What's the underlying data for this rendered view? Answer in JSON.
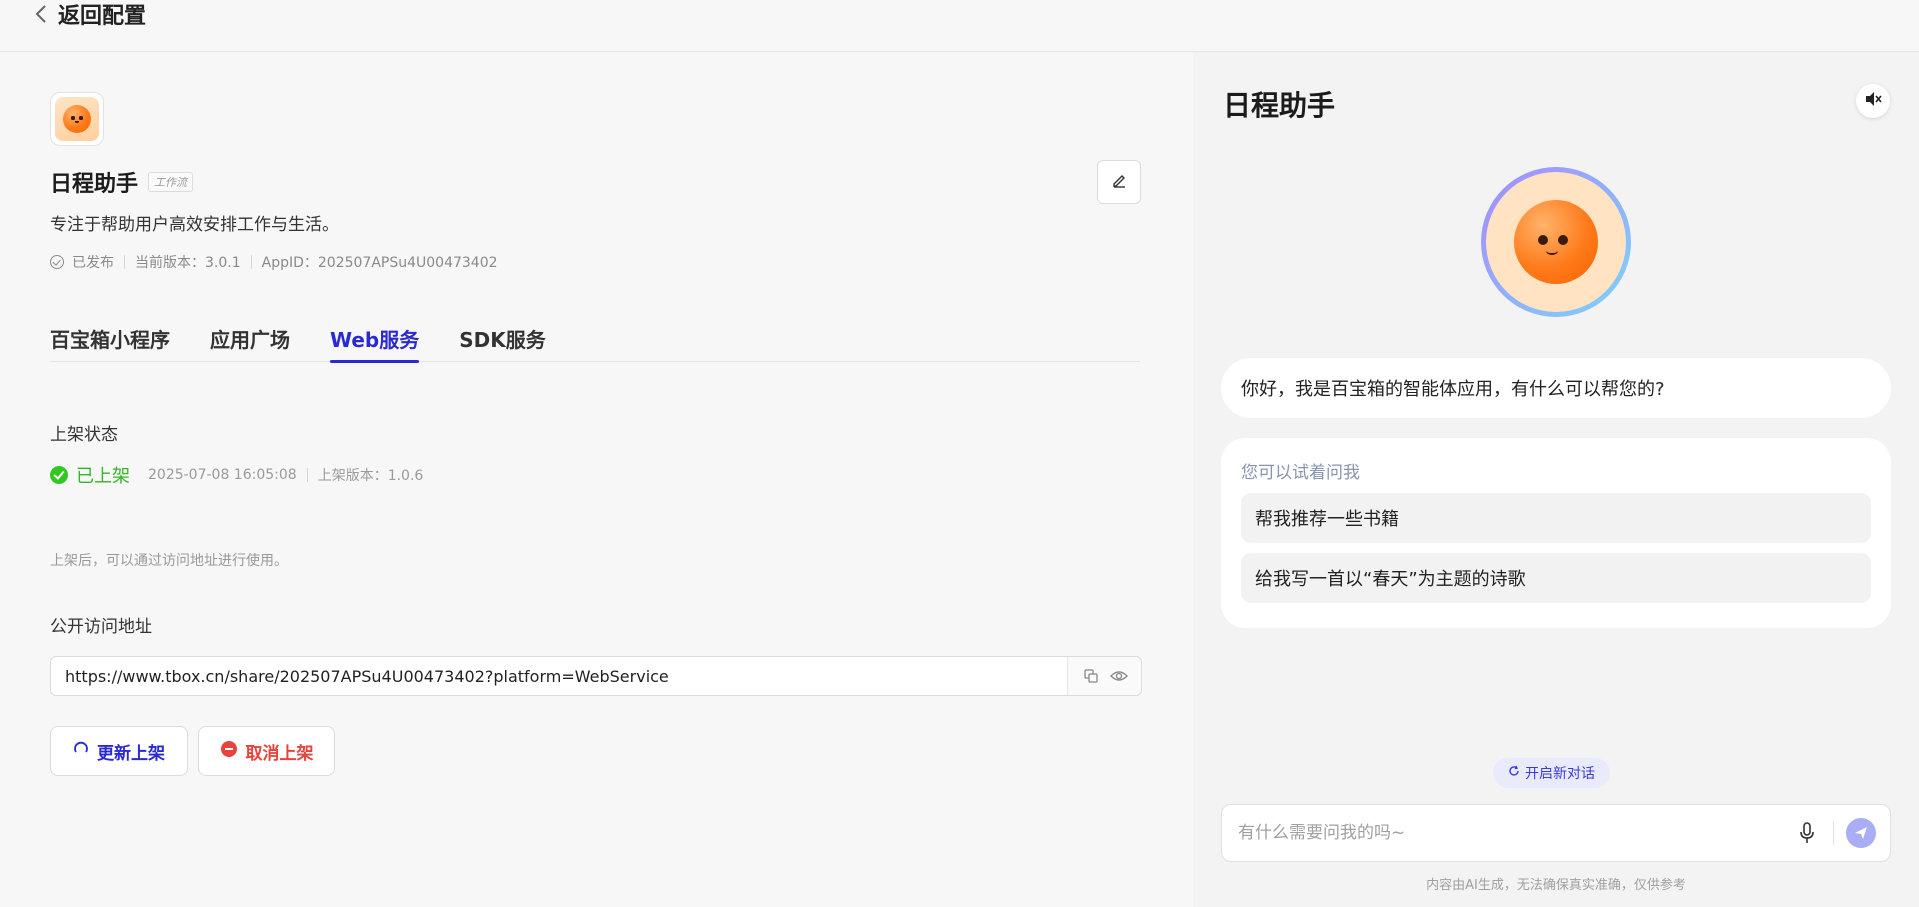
{
  "header": {
    "back_label": "返回配置"
  },
  "app": {
    "name": "日程助手",
    "type_badge": "工作流",
    "description": "专注于帮助用户高效安排工作与生活。",
    "status": "已发布",
    "version": "当前版本：3.0.1",
    "app_id": "AppID：202507APSu4U00473402"
  },
  "tabs": [
    {
      "label": "百宝箱小程序",
      "active": false
    },
    {
      "label": "应用广场",
      "active": false
    },
    {
      "label": "Web服务",
      "active": true
    },
    {
      "label": "SDK服务",
      "active": false
    }
  ],
  "listing": {
    "section_label": "上架状态",
    "status": "已上架",
    "timestamp": "2025-07-08 16:05:08",
    "listed_version": "上架版本：1.0.6",
    "hint": "上架后，可以通过访问地址进行使用。"
  },
  "public_url": {
    "section_label": "公开访问地址",
    "value": "https://www.tbox.cn/share/202507APSu4U00473402?platform=WebService"
  },
  "actions": {
    "update": "更新上架",
    "cancel": "取消上架"
  },
  "chat": {
    "title": "日程助手",
    "greeting": "你好，我是百宝箱的智能体应用，有什么可以帮您的?",
    "suggest_title": "您可以试着问我",
    "suggestions": [
      "帮我推荐一些书籍",
      "给我写一首以“春天”为主题的诗歌"
    ],
    "new_chat": "开启新对话",
    "input_placeholder": "有什么需要问我的吗~",
    "disclaimer": "内容由AI生成，无法确保真实准确，仅供参考"
  },
  "colors": {
    "accent": "#2a2ad4",
    "success": "#34c724",
    "danger": "#e8423d"
  }
}
